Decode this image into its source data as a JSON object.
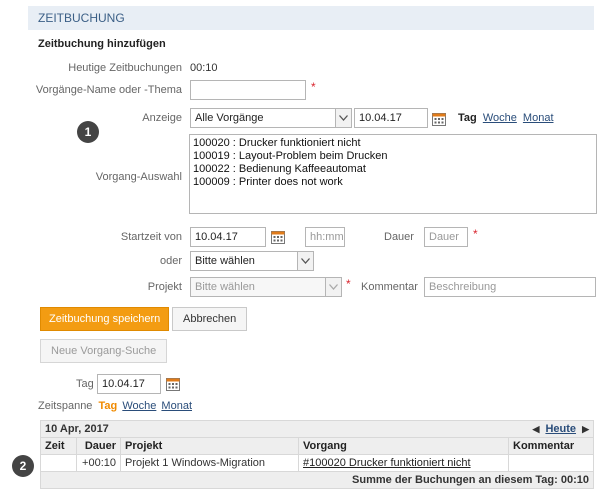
{
  "header": {
    "title": "ZEITBUCHUNG"
  },
  "form": {
    "section_title": "Zeitbuchung hinzufügen",
    "today_label": "Heutige Zeitbuchungen",
    "today_value": "00:10",
    "name_label": "Vorgänge-Name oder -Thema",
    "name_value": "",
    "anzeige_label": "Anzeige",
    "anzeige_selected": "Alle Vorgänge",
    "anzeige_date": "10.04.17",
    "range_tag": "Tag",
    "range_woche": "Woche",
    "range_monat": "Monat",
    "auswahl_label": "Vorgang-Auswahl",
    "auswahl_items": [
      "100020 : Drucker funktioniert nicht",
      "100019 : Layout-Problem beim Drucken",
      "100022 : Bedienung Kaffeeautomat",
      "100009 : Printer does not work"
    ],
    "start_label": "Startzeit von",
    "start_date": "10.04.17",
    "start_time_placeholder": "hh:mm",
    "dauer_label": "Dauer",
    "dauer_placeholder": "Dauer",
    "oder_label": "oder",
    "oder_selected": "Bitte wählen",
    "projekt_label": "Projekt",
    "projekt_selected": "Bitte wählen",
    "kommentar_label": "Kommentar",
    "kommentar_placeholder": "Beschreibung",
    "required_mark": "*",
    "save_label": "Zeitbuchung speichern",
    "cancel_label": "Abbrechen",
    "new_search_label": "Neue Vorgang-Suche"
  },
  "filter": {
    "tag_label": "Tag",
    "tag_date": "10.04.17",
    "zeitspanne_label": "Zeitspanne",
    "tag": "Tag",
    "woche": "Woche",
    "monat": "Monat"
  },
  "table": {
    "date_heading": "10 Apr, 2017",
    "heute_label": "Heute",
    "columns": [
      "Zeit",
      "Dauer",
      "Projekt",
      "Vorgang",
      "Kommentar"
    ],
    "rows": [
      {
        "zeit": "",
        "dauer": "+00:10",
        "projekt": "Projekt 1 Windows-Migration",
        "vorgang": "#100020 Drucker funktioniert nicht",
        "kommentar": ""
      }
    ],
    "sum_label": "Summe der Buchungen an diesem Tag: 00:10"
  },
  "markers": {
    "one": "1",
    "two": "2"
  },
  "colors": {
    "accent": "#f39c12",
    "header_bg": "#e8eef5",
    "link": "#2a4d7a",
    "required": "#d9262f"
  },
  "icons": {
    "calendar": "calendar-icon",
    "dropdown": "chevron-down-icon",
    "prev": "arrow-left-icon",
    "next": "arrow-right-icon"
  }
}
